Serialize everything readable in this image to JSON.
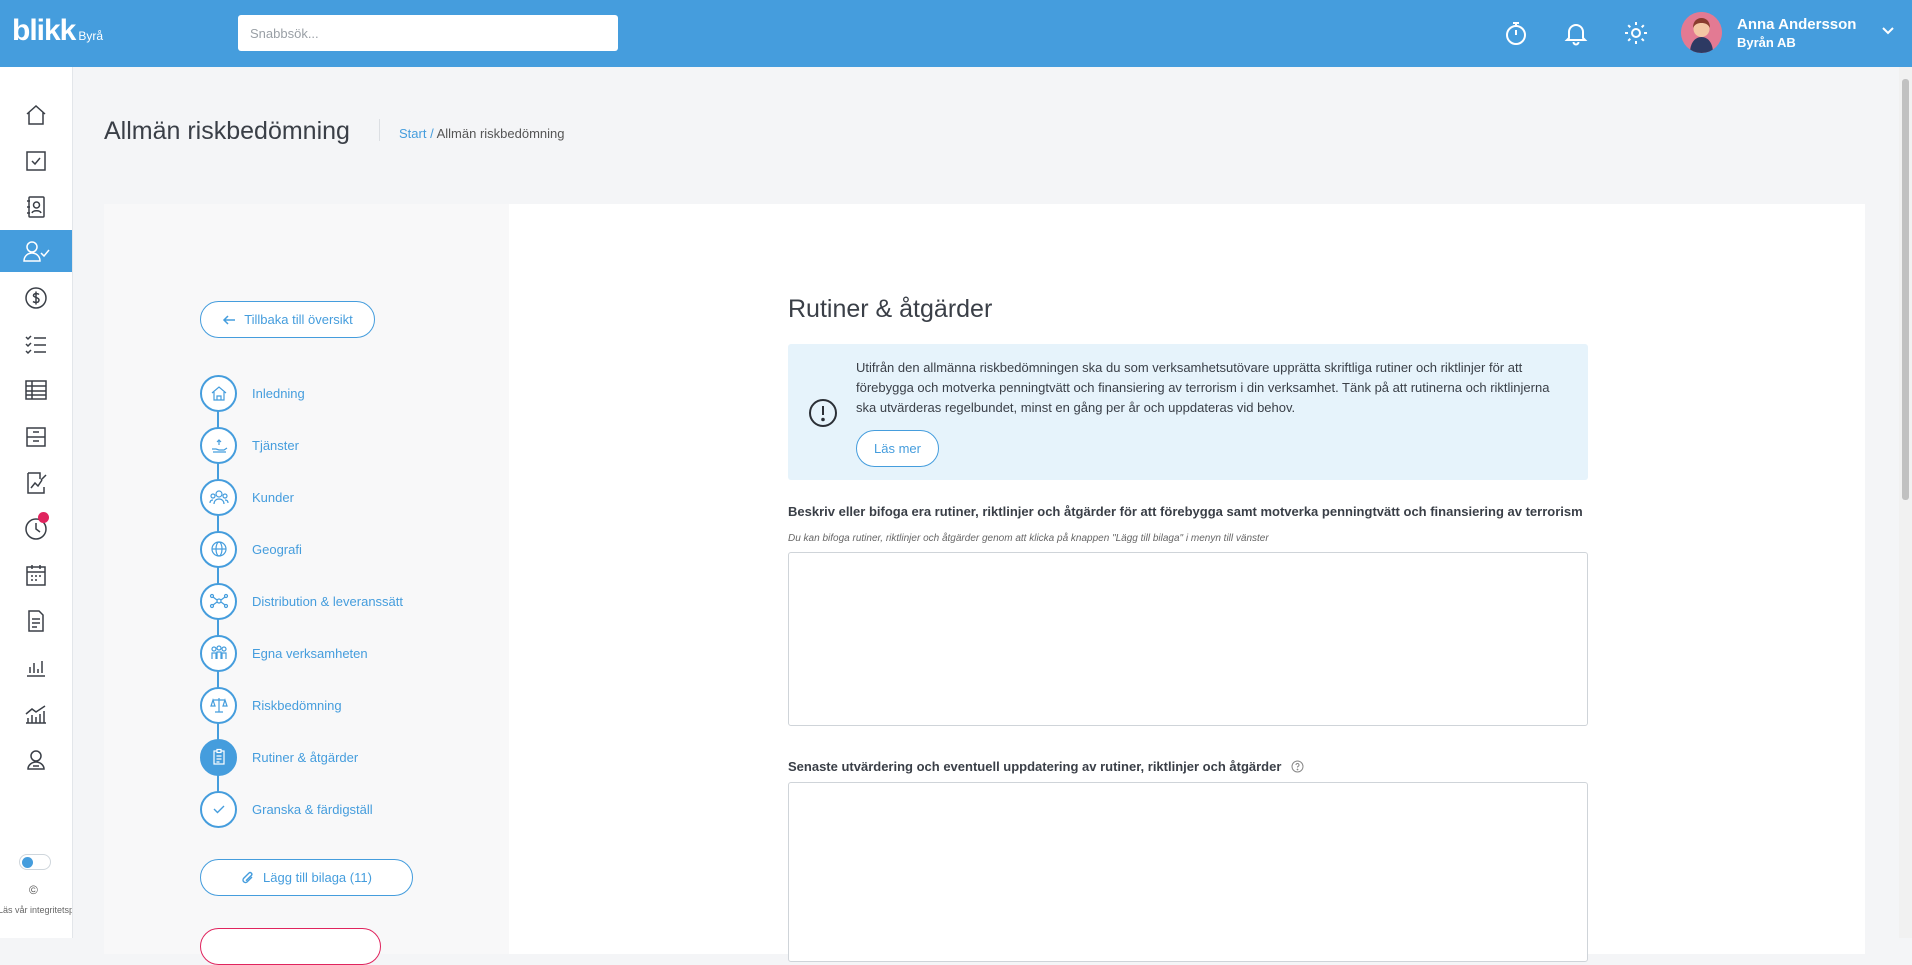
{
  "header": {
    "logo_brand": "blikk",
    "logo_sub": "Byrå",
    "search_placeholder": "Snabbsök...",
    "user_name": "Anna Andersson",
    "user_company": "Byrån AB"
  },
  "sidebar": {
    "items": [
      "home-icon",
      "tasks-icon",
      "contacts-icon",
      "client-check-icon",
      "finance-icon",
      "checklist-icon",
      "table-icon",
      "archive-icon",
      "sign-icon",
      "time-icon",
      "calendar-icon",
      "document-icon",
      "reports-icon",
      "analytics-icon",
      "support-icon"
    ],
    "active_index": 3,
    "copyright": "©",
    "privacy": "Läs vår integritetspolicy"
  },
  "page": {
    "title": "Allmän riskbedömning",
    "breadcrumb_start": "Start",
    "breadcrumb_sep": " / ",
    "breadcrumb_current": "Allmän riskbedömning"
  },
  "steps": {
    "back_label": "Tillbaka till översikt",
    "items": [
      {
        "label": "Inledning",
        "icon": "house-icon"
      },
      {
        "label": "Tjänster",
        "icon": "service-hand-icon"
      },
      {
        "label": "Kunder",
        "icon": "customers-icon"
      },
      {
        "label": "Geografi",
        "icon": "globe-icon"
      },
      {
        "label": "Distribution & leveranssätt",
        "icon": "network-icon"
      },
      {
        "label": "Egna verksamheten",
        "icon": "team-icon"
      },
      {
        "label": "Riskbedömning",
        "icon": "scale-icon"
      },
      {
        "label": "Rutiner & åtgärder",
        "icon": "clipboard-icon"
      },
      {
        "label": "Granska & färdigställ",
        "icon": "check-icon"
      }
    ],
    "active_index": 7,
    "attach_label": "Lägg till bilaga (11)"
  },
  "main": {
    "heading": "Rutiner & åtgärder",
    "info_text": "Utifrån den allmänna riskbedömningen ska du som verksamhetsutövare upprätta skriftliga rutiner och riktlinjer för att förebygga och motverka penningtvätt och finansiering av terrorism i din verksamhet. Tänk på att rutinerna och riktlinjerna ska utvärderas regelbundet, minst en gång per år och uppdateras vid behov.",
    "read_more": "Läs mer",
    "field1_label": "Beskriv eller bifoga era rutiner, riktlinjer och åtgärder för att förebygga samt motverka penningtvätt och finansiering av terrorism",
    "field1_hint": "Du kan bifoga rutiner, riktlinjer och åtgärder genom att klicka på knappen \"Lägg till bilaga\" i menyn till vänster",
    "field1_value": "",
    "field2_label": "Senaste utvärdering och eventuell uppdatering av rutiner, riktlinjer och åtgärder",
    "field2_value": ""
  },
  "colors": {
    "accent": "#459ddd",
    "danger": "#e0245e",
    "info_bg": "#e6f3fb"
  }
}
